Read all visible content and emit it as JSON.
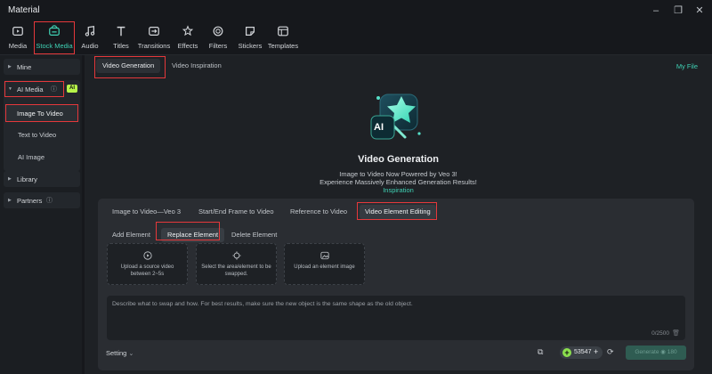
{
  "window": {
    "title": "Material"
  },
  "toolbar": {
    "items": [
      {
        "label": "Media",
        "icon": "media-icon"
      },
      {
        "label": "Stock Media",
        "icon": "stock-media-icon"
      },
      {
        "label": "Audio",
        "icon": "audio-icon"
      },
      {
        "label": "Titles",
        "icon": "titles-icon"
      },
      {
        "label": "Transitions",
        "icon": "transitions-icon"
      },
      {
        "label": "Effects",
        "icon": "effects-icon"
      },
      {
        "label": "Filters",
        "icon": "filters-icon"
      },
      {
        "label": "Stickers",
        "icon": "stickers-icon"
      },
      {
        "label": "Templates",
        "icon": "templates-icon"
      }
    ],
    "active_index": 1
  },
  "sidebar": {
    "mine": "Mine",
    "ai_media": "AI Media",
    "ai_badge": "AI",
    "image_to_video": "Image To Video",
    "text_to_video": "Text to Video",
    "ai_image": "AI Image",
    "library": "Library",
    "partners": "Partners"
  },
  "main": {
    "tab_video_generation": "Video Generation",
    "tab_video_inspiration": "Video Inspiration",
    "my_file": "My File",
    "hero": {
      "logo_text": "AI",
      "title": "Video Generation",
      "line1": "Image to Video Now Powered by Veo 3!",
      "line2": "Experience Massively Enhanced Generation Results!",
      "link": "Inspiration"
    }
  },
  "panel": {
    "tabs": [
      "Image to Video—Veo 3",
      "Start/End Frame to Video",
      "Reference to Video",
      "Video Element Editing"
    ],
    "active_tab": 3,
    "sub_tabs": [
      "Add Element",
      "Replace Element",
      "Delete Element"
    ],
    "active_sub_tab": 1,
    "cards": [
      {
        "text": "Upload a source video between 2~5s",
        "icon": "video-upload-icon"
      },
      {
        "text": "Select the area/element to be swapped.",
        "icon": "target-icon"
      },
      {
        "text": "Upload an element image",
        "icon": "image-upload-icon"
      }
    ],
    "prompt_placeholder": "Describe what to swap and how. For best results, make sure the new object is the same shape as the old object.",
    "counter": "0/2500",
    "setting": "Setting",
    "credits": "53547",
    "generate_label": "Generate",
    "generate_cost": "180"
  },
  "colors": {
    "accent": "#3fd1b4",
    "highlight_box": "#e5383b",
    "ai_badge": "#b7f54a"
  }
}
